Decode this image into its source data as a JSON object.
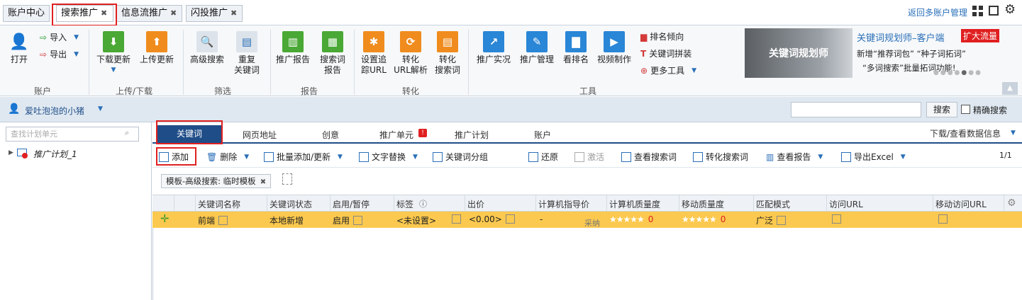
{
  "top_tabs": [
    {
      "label": "账户中心"
    },
    {
      "label": "搜索推广",
      "close": "✖"
    },
    {
      "label": "信息流推广",
      "close": "✖"
    },
    {
      "label": "闪投推广",
      "close": "✖"
    }
  ],
  "header": {
    "multi_account": "返回多账户管理"
  },
  "ribbon": {
    "account": {
      "open": "打开",
      "import": "导入",
      "export": "导出",
      "label": "账户"
    },
    "updown": {
      "download": "下载更新",
      "upload": "上传更新",
      "label": "上传/下载"
    },
    "filter": {
      "advanced_search": "高级搜索",
      "dup_1": "重复",
      "dup_2": "关键词",
      "label": "筛选"
    },
    "report": {
      "promo_report": "推广报告",
      "kw_1": "搜索词",
      "kw_2": "报告",
      "label": "报告"
    },
    "convert": {
      "track_1": "设置追",
      "track_2": "踪URL",
      "url_1": "转化",
      "url_2": "URL解析",
      "search_1": "转化",
      "search_2": "搜索词",
      "label": "转化"
    },
    "tools": {
      "live": "推广实况",
      "manage": "推广管理",
      "rank": "看排名",
      "video": "视频制作",
      "rank_trend": "排名倾向",
      "kw_join": "关键词拼装",
      "more": "更多工具",
      "label": "工具"
    }
  },
  "ad": {
    "image_text": "关键词规划师",
    "title": "关键词规划师–客户端",
    "badge": "扩大流量",
    "line1": "新增“推荐词包” “种子词拓词”",
    "line2": "“多词搜索”批量拓词功能!"
  },
  "account_bar": {
    "user": "爱吐泡泡的小猪",
    "search_button": "搜索",
    "exact_search": "精确搜索"
  },
  "left_panel": {
    "search_placeholder": "查找计划单元",
    "plan": "推广计划_1"
  },
  "main_tabs": [
    "关键词",
    "网页地址",
    "创意",
    "推广单元",
    "推广计划",
    "账户"
  ],
  "main_tabs_right": "下载/查看数据信息",
  "toolbar": {
    "add": "添加",
    "delete": "删除",
    "batch_add": "批量添加/更新",
    "text_replace": "文字替换",
    "kw_group": "关键词分组",
    "restore": "还原",
    "activate": "激活",
    "view_search": "查看搜索词",
    "convert_search": "转化搜索词",
    "view_report": "查看报告",
    "export_excel": "导出Excel",
    "page": "1/1"
  },
  "template_chip": "模板-高级搜索: 临时模板",
  "grid": {
    "headers": [
      "关键词名称",
      "关键词状态",
      "启用/暂停",
      "标签",
      "出价",
      "计算机指导价",
      "计算机质量度",
      "移动质量度",
      "匹配模式",
      "访问URL",
      "移动访问URL"
    ],
    "row": {
      "name": "前端",
      "status": "本地新增",
      "enable": "启用",
      "tag": "<未设置>",
      "bid": "<0.00>",
      "guide_price": "-",
      "adopt": "采纳",
      "pc_quality": "0",
      "mobile_quality": "0",
      "match": "广泛"
    }
  },
  "colors": {
    "accent": "#1f4d88",
    "highlight_row": "#fbc94f",
    "red_box": "#e02020"
  }
}
